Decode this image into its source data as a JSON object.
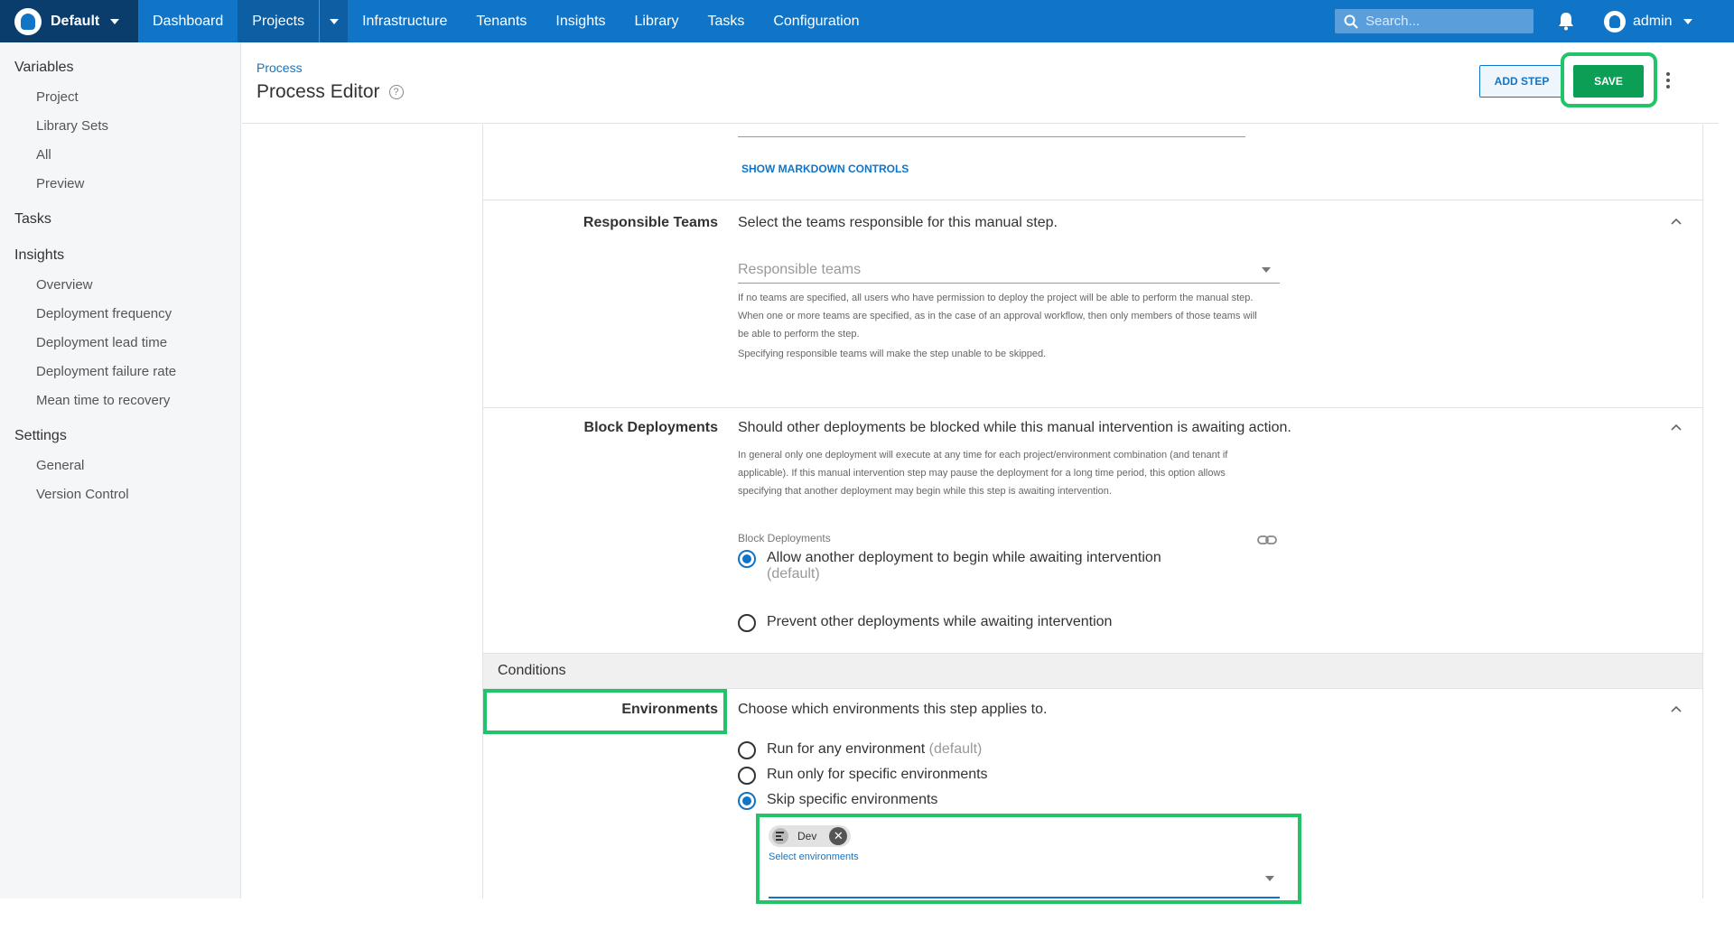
{
  "topnav": {
    "space": "Default",
    "items": [
      "Dashboard",
      "Projects",
      "Infrastructure",
      "Tenants",
      "Insights",
      "Library",
      "Tasks",
      "Configuration"
    ],
    "search_placeholder": "Search...",
    "user": "admin"
  },
  "sidebar": {
    "variables": "Variables",
    "variables_items": [
      "Project",
      "Library Sets",
      "All",
      "Preview"
    ],
    "tasks": "Tasks",
    "insights": "Insights",
    "insights_items": [
      "Overview",
      "Deployment frequency",
      "Deployment lead time",
      "Deployment failure rate",
      "Mean time to recovery"
    ],
    "settings": "Settings",
    "settings_items": [
      "General",
      "Version Control"
    ]
  },
  "header": {
    "breadcrumb": "Process",
    "title": "Process Editor",
    "add_step": "ADD STEP",
    "save": "SAVE"
  },
  "markdown": {
    "show_controls": "SHOW MARKDOWN CONTROLS"
  },
  "responsible_teams": {
    "label": "Responsible Teams",
    "description": "Select the teams responsible for this manual step.",
    "placeholder": "Responsible teams",
    "hint1": "If no teams are specified, all users who have permission to deploy the project will be able to perform the manual step. When one or more teams are specified, as in the case of an approval workflow, then only members of those teams will be able to perform the step.",
    "hint2": "Specifying responsible teams will make the step unable to be skipped."
  },
  "block_deployments": {
    "label": "Block Deployments",
    "description": "Should other deployments be blocked while this manual intervention is awaiting action.",
    "hint": "In general only one deployment will execute at any time for each project/environment combination (and tenant if applicable). If this manual intervention step may pause the deployment for a long time period, this option allows specifying that another deployment may begin while this step is awaiting intervention.",
    "field_label": "Block Deployments",
    "option_allow": "Allow another deployment to begin while awaiting intervention",
    "option_allow_default": "(default)",
    "option_prevent": "Prevent other deployments while awaiting intervention"
  },
  "conditions": {
    "heading": "Conditions",
    "environments_label": "Environments",
    "environments_description": "Choose which environments this step applies to.",
    "option_any": "Run for any environment",
    "option_any_default": "(default)",
    "option_specific": "Run only for specific environments",
    "option_skip": "Skip specific environments",
    "chip": "Dev",
    "select_label": "Select environments"
  }
}
